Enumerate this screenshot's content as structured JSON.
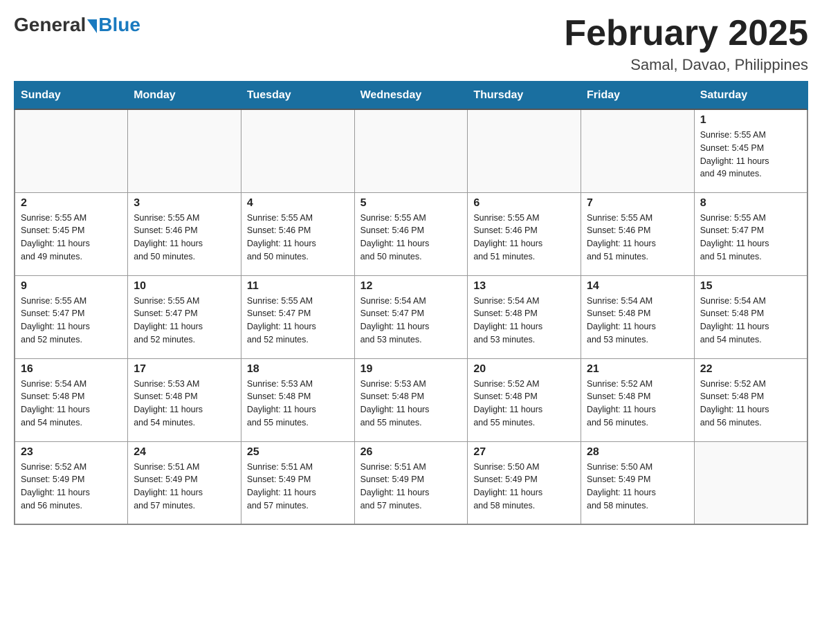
{
  "header": {
    "logo_general": "General",
    "logo_blue": "Blue",
    "month_title": "February 2025",
    "location": "Samal, Davao, Philippines"
  },
  "days_of_week": [
    "Sunday",
    "Monday",
    "Tuesday",
    "Wednesday",
    "Thursday",
    "Friday",
    "Saturday"
  ],
  "weeks": [
    [
      {
        "day": "",
        "info": ""
      },
      {
        "day": "",
        "info": ""
      },
      {
        "day": "",
        "info": ""
      },
      {
        "day": "",
        "info": ""
      },
      {
        "day": "",
        "info": ""
      },
      {
        "day": "",
        "info": ""
      },
      {
        "day": "1",
        "info": "Sunrise: 5:55 AM\nSunset: 5:45 PM\nDaylight: 11 hours\nand 49 minutes."
      }
    ],
    [
      {
        "day": "2",
        "info": "Sunrise: 5:55 AM\nSunset: 5:45 PM\nDaylight: 11 hours\nand 49 minutes."
      },
      {
        "day": "3",
        "info": "Sunrise: 5:55 AM\nSunset: 5:46 PM\nDaylight: 11 hours\nand 50 minutes."
      },
      {
        "day": "4",
        "info": "Sunrise: 5:55 AM\nSunset: 5:46 PM\nDaylight: 11 hours\nand 50 minutes."
      },
      {
        "day": "5",
        "info": "Sunrise: 5:55 AM\nSunset: 5:46 PM\nDaylight: 11 hours\nand 50 minutes."
      },
      {
        "day": "6",
        "info": "Sunrise: 5:55 AM\nSunset: 5:46 PM\nDaylight: 11 hours\nand 51 minutes."
      },
      {
        "day": "7",
        "info": "Sunrise: 5:55 AM\nSunset: 5:46 PM\nDaylight: 11 hours\nand 51 minutes."
      },
      {
        "day": "8",
        "info": "Sunrise: 5:55 AM\nSunset: 5:47 PM\nDaylight: 11 hours\nand 51 minutes."
      }
    ],
    [
      {
        "day": "9",
        "info": "Sunrise: 5:55 AM\nSunset: 5:47 PM\nDaylight: 11 hours\nand 52 minutes."
      },
      {
        "day": "10",
        "info": "Sunrise: 5:55 AM\nSunset: 5:47 PM\nDaylight: 11 hours\nand 52 minutes."
      },
      {
        "day": "11",
        "info": "Sunrise: 5:55 AM\nSunset: 5:47 PM\nDaylight: 11 hours\nand 52 minutes."
      },
      {
        "day": "12",
        "info": "Sunrise: 5:54 AM\nSunset: 5:47 PM\nDaylight: 11 hours\nand 53 minutes."
      },
      {
        "day": "13",
        "info": "Sunrise: 5:54 AM\nSunset: 5:48 PM\nDaylight: 11 hours\nand 53 minutes."
      },
      {
        "day": "14",
        "info": "Sunrise: 5:54 AM\nSunset: 5:48 PM\nDaylight: 11 hours\nand 53 minutes."
      },
      {
        "day": "15",
        "info": "Sunrise: 5:54 AM\nSunset: 5:48 PM\nDaylight: 11 hours\nand 54 minutes."
      }
    ],
    [
      {
        "day": "16",
        "info": "Sunrise: 5:54 AM\nSunset: 5:48 PM\nDaylight: 11 hours\nand 54 minutes."
      },
      {
        "day": "17",
        "info": "Sunrise: 5:53 AM\nSunset: 5:48 PM\nDaylight: 11 hours\nand 54 minutes."
      },
      {
        "day": "18",
        "info": "Sunrise: 5:53 AM\nSunset: 5:48 PM\nDaylight: 11 hours\nand 55 minutes."
      },
      {
        "day": "19",
        "info": "Sunrise: 5:53 AM\nSunset: 5:48 PM\nDaylight: 11 hours\nand 55 minutes."
      },
      {
        "day": "20",
        "info": "Sunrise: 5:52 AM\nSunset: 5:48 PM\nDaylight: 11 hours\nand 55 minutes."
      },
      {
        "day": "21",
        "info": "Sunrise: 5:52 AM\nSunset: 5:48 PM\nDaylight: 11 hours\nand 56 minutes."
      },
      {
        "day": "22",
        "info": "Sunrise: 5:52 AM\nSunset: 5:48 PM\nDaylight: 11 hours\nand 56 minutes."
      }
    ],
    [
      {
        "day": "23",
        "info": "Sunrise: 5:52 AM\nSunset: 5:49 PM\nDaylight: 11 hours\nand 56 minutes."
      },
      {
        "day": "24",
        "info": "Sunrise: 5:51 AM\nSunset: 5:49 PM\nDaylight: 11 hours\nand 57 minutes."
      },
      {
        "day": "25",
        "info": "Sunrise: 5:51 AM\nSunset: 5:49 PM\nDaylight: 11 hours\nand 57 minutes."
      },
      {
        "day": "26",
        "info": "Sunrise: 5:51 AM\nSunset: 5:49 PM\nDaylight: 11 hours\nand 57 minutes."
      },
      {
        "day": "27",
        "info": "Sunrise: 5:50 AM\nSunset: 5:49 PM\nDaylight: 11 hours\nand 58 minutes."
      },
      {
        "day": "28",
        "info": "Sunrise: 5:50 AM\nSunset: 5:49 PM\nDaylight: 11 hours\nand 58 minutes."
      },
      {
        "day": "",
        "info": ""
      }
    ]
  ]
}
